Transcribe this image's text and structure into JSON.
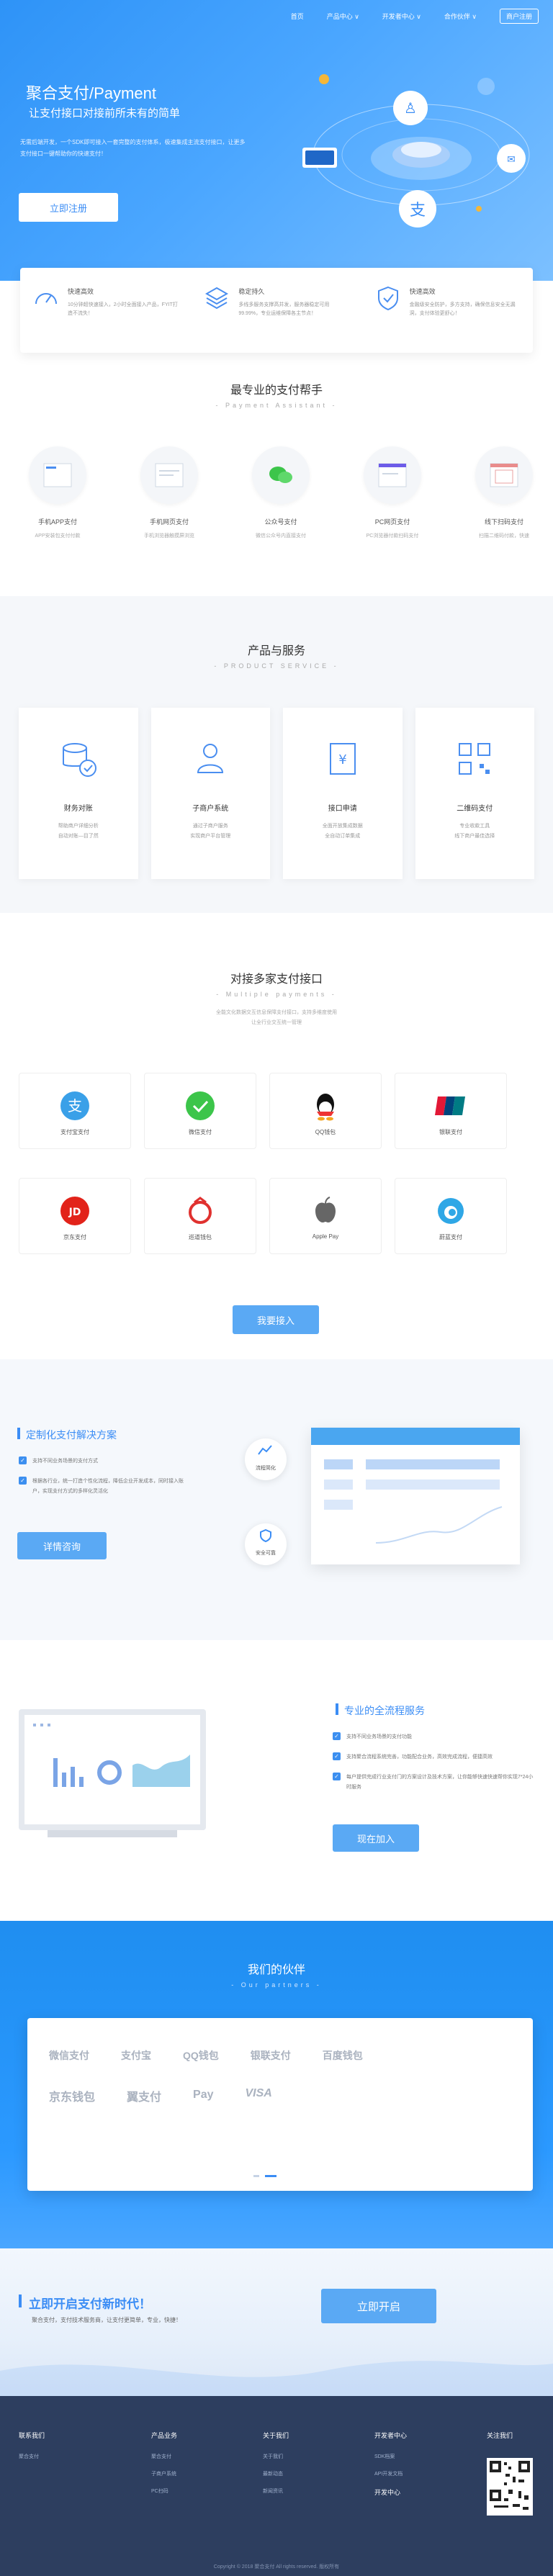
{
  "nav": {
    "items": [
      "首页",
      "产品中心 ∨",
      "开发者中心 ∨",
      "合作伙伴 ∨"
    ],
    "login": "商户注册"
  },
  "hero": {
    "title": "聚合支付/Payment",
    "subtitle": "让支付接口对接前所未有的简单",
    "desc": "无需后端开发，一个SDK即可接入一套完整的支付体系，极速集成主流支付接口，让更多支付接口一键帮助你的快速支付！",
    "button": "立即注册"
  },
  "features": [
    {
      "title": "快速高效",
      "desc": "10分钟超快速接入，2小时全面接入产品，FYIT打造不流失！"
    },
    {
      "title": "稳定持久",
      "desc": "多线多服务支撑高并发，服务器稳定可用99.99%，专业运维保障各主节点！"
    },
    {
      "title": "快速高效",
      "desc": "金融级安全防护，多方支持，确保信息安全无漏洞，支付体验更舒心！"
    }
  ],
  "helper": {
    "title": "最专业的支付帮手",
    "subtitle": "- Payment Assistant -",
    "items": [
      {
        "name": "手机APP支付",
        "desc": "APP安装包支付付款"
      },
      {
        "name": "手机网页支付",
        "desc": "手机浏览器触摸屏浏览"
      },
      {
        "name": "公众号支付",
        "desc": "微信公众号内直接支付"
      },
      {
        "name": "PC网页支付",
        "desc": "PC浏览器付款扫码支付"
      },
      {
        "name": "线下扫码支付",
        "desc": "扫描二维码付款，快速"
      }
    ]
  },
  "service": {
    "title": "产品与服务",
    "subtitle": "- PRODUCT SERVICE -",
    "cards": [
      {
        "name": "财务对账",
        "desc1": "帮助商户详细分析",
        "desc2": "自动对账—目了然"
      },
      {
        "name": "子商户系统",
        "desc1": "通过子商户服务",
        "desc2": "实现商户平台管理"
      },
      {
        "name": "接口申请",
        "desc1": "全面开放集成数据",
        "desc2": "全自动订单集成"
      },
      {
        "name": "二维码支付",
        "desc1": "专业收款工具",
        "desc2": "线下商户最佳选择"
      }
    ]
  },
  "multi": {
    "title": "对接多家支付接口",
    "subtitle": "- Multiple payments -",
    "line1": "全能文化数据交互信息保障支付接口，支持多维度使用",
    "line2": "让全行业交互统一管理",
    "pays": [
      "支付宝支付",
      "微信支付",
      "QQ钱包",
      "银联支付",
      "京东支付",
      "巡道钱包",
      "Apple Pay",
      "蔚蓝支付"
    ],
    "button": "我要接入"
  },
  "custom": {
    "title": "定制化支付解决方案",
    "bullet1": "支持不同业务场景的支付方式",
    "bullet2": "根据各行业，统一打造个性化流程，降低企业开发成本，同时接入账户，实现支付方式的多样化灵活化",
    "button": "详情咨询",
    "badge1": "流程简化",
    "badge2": "安全可靠"
  },
  "flow": {
    "title": "专业的全流程服务",
    "bullet1": "支持不同业务场景的支付功能",
    "bullet2": "支持聚合流程系统完善，功能配合业务，高效完成流程，便捷高效",
    "bullet3": "每户提供完成行业支付门的方案设计及技术方案，让你能够快速快速帮你实现7*24小时服务",
    "button": "现在加入"
  },
  "partner": {
    "title": "我们的伙伴",
    "subtitle": "- Our partners -",
    "logos": [
      "微信支付",
      "支付宝",
      "QQ钱包",
      "银联支付",
      "百度钱包",
      "京东钱包",
      "翼支付",
      "Pay",
      "VISA"
    ]
  },
  "cta": {
    "title": "立即开启支付新时代！",
    "desc": "聚合支付，支付技术服务商，让支付更简单，专业，快捷！",
    "button": "立即开启"
  },
  "footer": {
    "cols": [
      {
        "head": "联系我们",
        "links": [
          "聚合支付"
        ]
      },
      {
        "head": "产品业务",
        "links": [
          "聚合支付",
          "子商户系统",
          "PC扫码"
        ]
      },
      {
        "head": "关于我们",
        "links": [
          "关于我们",
          "最新动态",
          "新闻资讯"
        ]
      },
      {
        "head": "开发者中心",
        "links": [
          "SDK档案",
          "API开发文档"
        ]
      },
      {
        "head": "关注我们",
        "links": []
      }
    ],
    "dev2": "开发中心",
    "copyright": "Copyright © 2018 聚合支付 All rights reserved. 版权所有"
  },
  "colors": {
    "primary": "#3b8df5",
    "footer": "#2d3e5f"
  }
}
